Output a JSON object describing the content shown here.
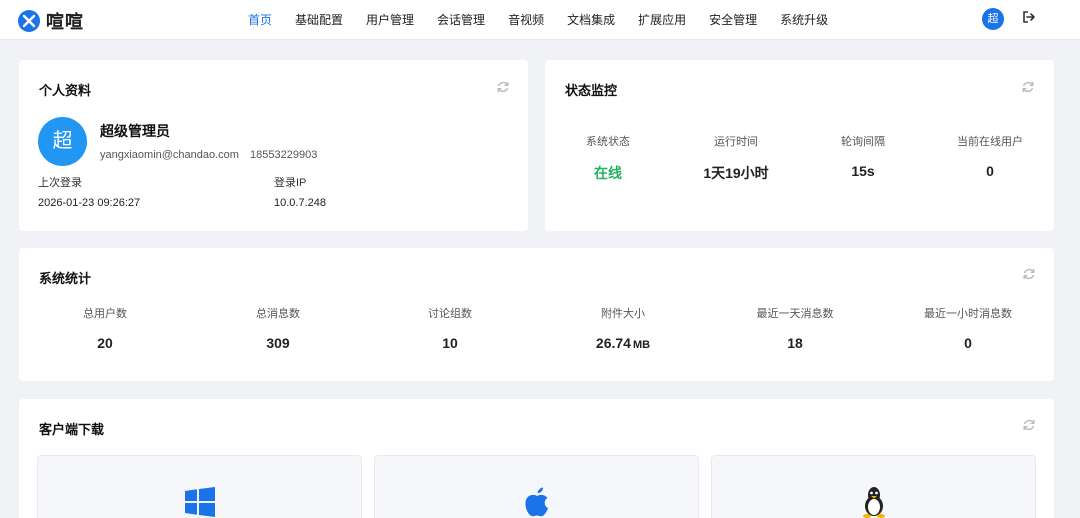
{
  "app": {
    "name": "喧喧",
    "avatar_char": "超"
  },
  "nav": {
    "items": [
      {
        "label": "首页",
        "active": true
      },
      {
        "label": "基础配置"
      },
      {
        "label": "用户管理"
      },
      {
        "label": "会话管理"
      },
      {
        "label": "音视频"
      },
      {
        "label": "文档集成"
      },
      {
        "label": "扩展应用"
      },
      {
        "label": "安全管理"
      },
      {
        "label": "系统升级"
      }
    ]
  },
  "profile": {
    "title": "个人资料",
    "avatar_char": "超",
    "name": "超级管理员",
    "email": "yangxiaomin@chandao.com",
    "phone": "18553229903",
    "last_login_label": "上次登录",
    "last_login_value": "2026-01-23 09:26:27",
    "login_ip_label": "登录IP",
    "login_ip_value": "10.0.7.248"
  },
  "monitor": {
    "title": "状态监控",
    "items": [
      {
        "label": "系统状态",
        "value": "在线"
      },
      {
        "label": "运行时间",
        "value": "1天19小时"
      },
      {
        "label": "轮询间隔",
        "value": "15s"
      },
      {
        "label": "当前在线用户",
        "value": "0"
      }
    ]
  },
  "stats": {
    "title": "系统统计",
    "items": [
      {
        "label": "总用户数",
        "value": "20"
      },
      {
        "label": "总消息数",
        "value": "309"
      },
      {
        "label": "讨论组数",
        "value": "10"
      },
      {
        "label": "附件大小",
        "value": "26.74",
        "unit": "MB"
      },
      {
        "label": "最近一天消息数",
        "value": "18"
      },
      {
        "label": "最近一小时消息数",
        "value": "0"
      }
    ]
  },
  "download": {
    "title": "客户端下载",
    "platforms": [
      "windows-icon",
      "apple-icon",
      "linux-icon"
    ]
  },
  "colors": {
    "accent": "#1a73e8",
    "online": "#22b35e",
    "background": "#f0f2f5"
  }
}
